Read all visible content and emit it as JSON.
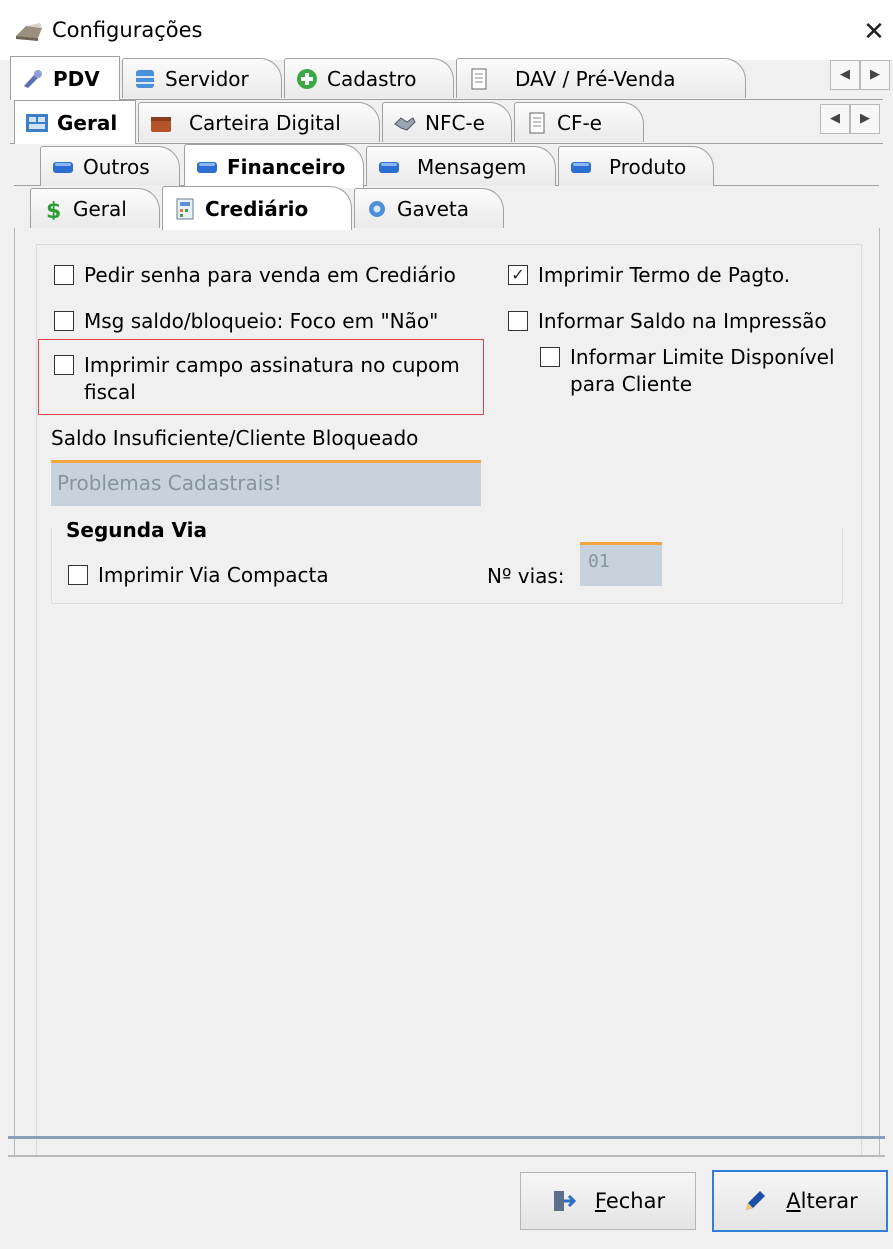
{
  "window": {
    "title": "Configurações",
    "close_glyph": "✕"
  },
  "tabs_row1": {
    "items": [
      {
        "label": "PDV",
        "icon": "tools-icon",
        "active": true
      },
      {
        "label": "Servidor",
        "icon": "database-icon"
      },
      {
        "label": "Cadastro",
        "icon": "plus-circle-icon"
      },
      {
        "label": "DAV / Pré-Venda",
        "icon": "document-icon"
      }
    ]
  },
  "tabs_row2": {
    "items": [
      {
        "label": "Geral",
        "icon": "grid-icon",
        "active": true
      },
      {
        "label": "Carteira Digital",
        "icon": "wallet-icon"
      },
      {
        "label": "NFC-e",
        "icon": "handshake-icon"
      },
      {
        "label": "CF-e",
        "icon": "document-icon"
      }
    ]
  },
  "tabs_row3": {
    "items": [
      {
        "label": "Outros",
        "icon": "blue-pill-icon"
      },
      {
        "label": "Financeiro",
        "icon": "blue-pill-icon",
        "active": true
      },
      {
        "label": "Mensagem",
        "icon": "blue-pill-icon"
      },
      {
        "label": "Produto",
        "icon": "blue-pill-icon"
      }
    ]
  },
  "tabs_row4": {
    "items": [
      {
        "label": "Geral",
        "icon": "dollar-icon"
      },
      {
        "label": "Crediário",
        "icon": "calculator-icon",
        "active": true
      },
      {
        "label": "Gaveta",
        "icon": "gear-icon"
      }
    ]
  },
  "options": {
    "pedir_senha": {
      "label": "Pedir senha para venda em Crediário",
      "checked": false
    },
    "msg_saldo": {
      "label": "Msg saldo/bloqueio: Foco em \"Não\"",
      "checked": false
    },
    "imprimir_assinatura": {
      "label_line1": "Imprimir campo assinatura no cupom",
      "label_line2": "fiscal",
      "checked": false
    },
    "imprimir_termo": {
      "label": "Imprimir Termo de Pagto.",
      "checked": true
    },
    "informar_saldo": {
      "label": "Informar Saldo na Impressão",
      "checked": false
    },
    "informar_limite": {
      "label_line1": "Informar Limite Disponível",
      "label_line2": "para Cliente",
      "checked": false
    }
  },
  "saldo": {
    "label": "Saldo Insuficiente/Cliente Bloqueado",
    "value": "Problemas Cadastrais!"
  },
  "segunda_via": {
    "title": "Segunda Via",
    "compacta_label": "Imprimir Via Compacta",
    "compacta_checked": false,
    "nvias_label": "Nº vias:",
    "nvias_value": "01"
  },
  "footer": {
    "fechar_label": "Fechar",
    "fechar_underline": "F",
    "fechar_rest": "echar",
    "alterar_underline": "A",
    "alterar_rest": "lterar"
  },
  "check_glyph": "✓",
  "colors": {
    "highlight": "#e0454b",
    "focus": "#2f7fd6",
    "input_bg": "#c8d2dc",
    "input_accent": "#f2a541"
  }
}
